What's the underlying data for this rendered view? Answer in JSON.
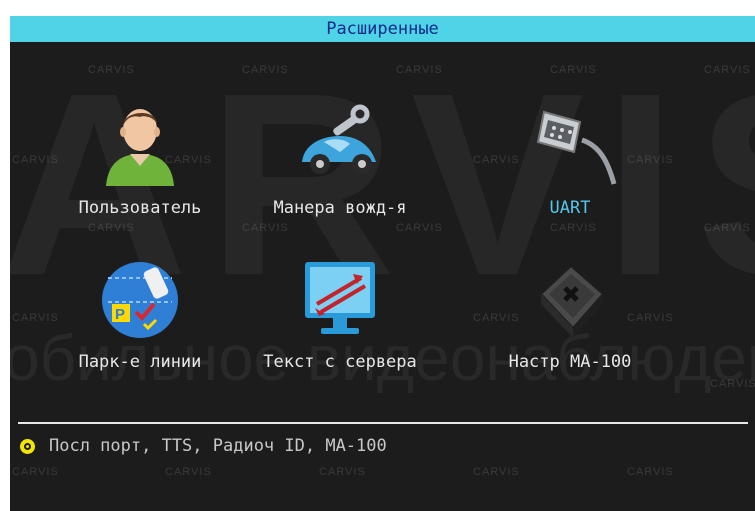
{
  "title": "Расширенные",
  "watermark": {
    "big": "ARVIS",
    "sub": "Мобильное видеонаблюдение",
    "small": "CARVIS"
  },
  "menu": [
    {
      "label": "Пользователь",
      "icon": "user-icon",
      "active": false
    },
    {
      "label": "Манера вожд-я",
      "icon": "driving-car-icon",
      "active": false
    },
    {
      "label": "UART",
      "icon": "serial-port-icon",
      "active": true
    },
    {
      "label": "Парк-е линии",
      "icon": "parking-lines-icon",
      "active": false
    },
    {
      "label": "Текст с сервера",
      "icon": "server-text-icon",
      "active": false
    },
    {
      "label": "Настр MA-100",
      "icon": "ma100-device-icon",
      "active": false
    }
  ],
  "status": {
    "text": "Посл порт, TTS, Радиоч ID, MA-100",
    "bullet_color": "#f2e600"
  },
  "colors": {
    "title_bar": "#4fd3e6",
    "title_text": "#0d2a8a",
    "background": "#1c1c1c",
    "active_label": "#52c7ea"
  }
}
